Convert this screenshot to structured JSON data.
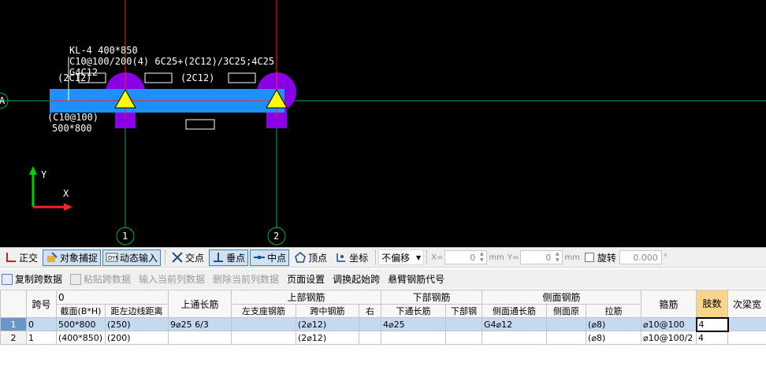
{
  "drawing": {
    "beam_label_1": "KL-4 400*850",
    "beam_label_2": "C10@100/200(4) 6C25+(2C12)/3C25;4C25",
    "beam_label_3": "G4C12",
    "left_top_annotation": "(2C12)",
    "mid_top_annotation": "(2C12)",
    "left_bottom_annotation_1": "(C10@100)",
    "left_bottom_annotation_2": "500*800",
    "axis_left_label": "A",
    "axis_1_label": "1",
    "axis_2_label": "2",
    "ucs_x": "X",
    "ucs_y": "Y"
  },
  "snapbar": {
    "ortho": "正交",
    "object_snap": "对象捕捉",
    "dynamic_input": "动态输入",
    "intersection": "交点",
    "perpendicular": "垂点",
    "midpoint": "中点",
    "vertex": "顶点",
    "coordinate": "坐标",
    "offset_mode": "不偏移",
    "x_label": "X=",
    "x_value": "0",
    "y_label": "Y=",
    "y_value": "0",
    "unit": "mm",
    "rotate_label": "旋转",
    "rotate_value": "0.000",
    "degree": "°"
  },
  "rowbar": {
    "copy_span": "复制跨数据",
    "paste_span": "粘贴跨数据",
    "input_current": "输入当前列数据",
    "delete_current": "删除当前列数据",
    "page_setup": "页面设置",
    "swap_start": "调换起始跨",
    "cantilever_code": "悬臂钢筋代号"
  },
  "grid": {
    "headers_top": {
      "span_no": "跨号",
      "partial": "0",
      "top_through": "上通长筋",
      "top_rebar": "上部钢筋",
      "bottom_rebar": "下部钢筋",
      "side_rebar": "侧面钢筋",
      "stirrup": "箍筋",
      "legs": "肢数",
      "secondary": "次梁宽"
    },
    "headers_sub": {
      "section": "截面(B*H)",
      "offset": "距左边线距离",
      "left_support": "左支座钢筋",
      "mid_span": "跨中钢筋",
      "right": "右",
      "bottom_through": "下通长筋",
      "bottom_rebar_short": "下部钢",
      "side_through": "侧面通长筋",
      "side_orig": "侧面原",
      "tie": "拉筋"
    },
    "rows": [
      {
        "num": "1",
        "span": "0",
        "section": "500*800",
        "offset": "(250)",
        "top_through": "9⌀25 6/3",
        "left_support": "",
        "mid_span": "(2⌀12)",
        "right": "",
        "bottom_through": "4⌀25",
        "bottom_rebar": "",
        "side_through": "G4⌀12",
        "side_orig": "",
        "tie": "(⌀8)",
        "stirrup": "⌀10@100",
        "legs": "4",
        "secondary": ""
      },
      {
        "num": "2",
        "span": "1",
        "section": "(400*850)",
        "offset": "(200)",
        "top_through": "",
        "left_support": "",
        "mid_span": "(2⌀12)",
        "right": "",
        "bottom_through": "",
        "bottom_rebar": "",
        "side_through": "",
        "side_orig": "",
        "tie": "(⌀8)",
        "stirrup": "⌀10@100/2",
        "legs": "4",
        "secondary": ""
      }
    ]
  },
  "colors": {
    "beam": "#1e90ff",
    "column": "#8a00e6",
    "support_marker": "#ffff00",
    "grid_axis": "#00b050",
    "beam_axis": "#ff2020",
    "canvas_bg": "#000000",
    "selection_row": "#c5daf1",
    "highlight_header": "#f7d58b"
  }
}
